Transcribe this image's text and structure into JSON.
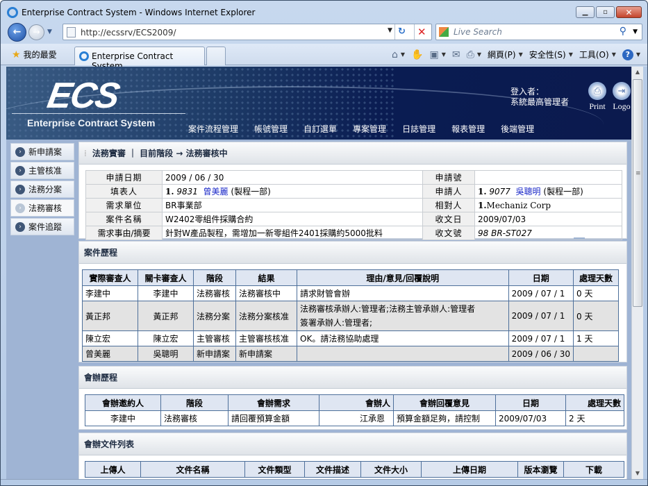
{
  "browser": {
    "window_title": "Enterprise Contract System - Windows Internet Explorer",
    "url": "http://ecssrv/ECS2009/",
    "search_placeholder": "Live Search",
    "favorites_label": "我的最愛",
    "tab_title": "Enterprise Contract System",
    "commands": {
      "page": "網頁(P)",
      "safety": "安全性(S)",
      "tools": "工具(O)"
    }
  },
  "header": {
    "logo": "ECS",
    "subtitle": "Enterprise Contract System",
    "login_label": "登入者：",
    "login_user": "系統最高管理者",
    "print_label": "Print",
    "logout_label": "Logo",
    "menu": [
      "案件流程管理",
      "帳號管理",
      "自訂選單",
      "專案管理",
      "日誌管理",
      "報表管理",
      "後端管理"
    ]
  },
  "sidebar": {
    "items": [
      {
        "label": "新申請案",
        "active": false
      },
      {
        "label": "主管核准",
        "active": false
      },
      {
        "label": "法務分案",
        "active": false
      },
      {
        "label": "法務審核",
        "active": true
      },
      {
        "label": "案件追蹤",
        "active": false
      }
    ]
  },
  "case_panel": {
    "title": "法務實審 ｜ 目前階段 → 法務審核中",
    "rows": [
      {
        "l1": "申請日期",
        "v1": "2009 / 06 / 30",
        "l2": "申請號",
        "v2": ""
      },
      {
        "l1": "填表人",
        "v1_num": "1.",
        "v1_id": "9831",
        "v1_name": "曾美麗",
        "v1_dept": "(製程一部)",
        "l2": "申請人",
        "v2_num": "1.",
        "v2_id": "9077",
        "v2_name": "吳聰明",
        "v2_dept": "(製程一部)"
      },
      {
        "l1": "需求單位",
        "v1": "BR事業部",
        "l2": "相對人",
        "v2_num": "1.",
        "v2": "Mechaniz Corp"
      },
      {
        "l1": "案件名稱",
        "v1": "W2402零組件採購合約",
        "l2": "收文日",
        "v2": "2009/07/03"
      },
      {
        "l1": "需求事由/摘要",
        "v1": "針對W產品製程，需增加一新零組件2401採購約5000批料",
        "l2": "收文號",
        "v2": "98 BR-ST027"
      }
    ]
  },
  "history": {
    "title": "案件歷程",
    "headers": [
      "實際審查人",
      "關卡審查人",
      "階段",
      "結果",
      "理由/意見/回覆說明",
      "日期",
      "處理天數"
    ],
    "rows": [
      {
        "actual": "李建中",
        "gate": "李建中",
        "stage": "法務審核",
        "result": "法務審核中",
        "reason": "請求財管會辦",
        "reason2": "",
        "date": "2009 / 07 / 1",
        "days": "0 天"
      },
      {
        "actual": "黃正邦",
        "gate": "黃正邦",
        "stage": "法務分案",
        "result": "法務分案核准",
        "reason": "法務審核承辦人:管理者;法務主管承辦人:管理者",
        "reason2": "簽署承辦人:管理者;",
        "date": "2009 / 07 / 1",
        "days": "0 天"
      },
      {
        "actual": "陳立宏",
        "gate": "陳立宏",
        "stage": "主管審核",
        "result": "主管審核核准",
        "reason": "OK。請法務協助處理",
        "reason2": "",
        "date": "2009 / 07 / 1",
        "days": "1 天"
      },
      {
        "actual": "曾美麗",
        "gate": "吳聰明",
        "stage": "新申請案",
        "result": "新申請案",
        "reason": "",
        "reason2": "",
        "date": "2009 / 06 / 30",
        "days": ""
      }
    ]
  },
  "countersign": {
    "title": "會辦歷程",
    "headers": [
      "會辦邀約人",
      "階段",
      "會辦需求",
      "會辦人",
      "會辦回覆意見",
      "日期",
      "處理天數"
    ],
    "rows": [
      {
        "inviter": "李建中",
        "stage": "法務審核",
        "request": "請回覆預算金額",
        "person": "江承恩",
        "reply": "預算金額足夠，請控制",
        "date": "2009/07/03",
        "days": "2 天"
      }
    ]
  },
  "documents": {
    "title": "會辦文件列表",
    "headers": [
      "上傳人",
      "文件名稱",
      "文件類型",
      "文件描述",
      "文件大小",
      "上傳日期",
      "版本瀏覽",
      "下載"
    ]
  }
}
